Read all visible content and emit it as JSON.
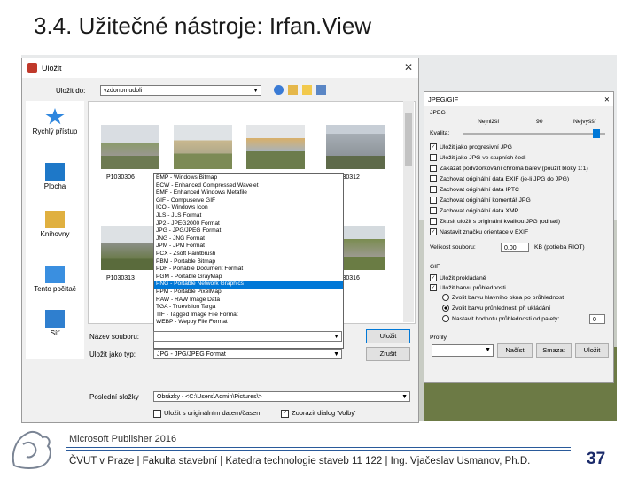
{
  "slide": {
    "title": "3.4. Užitečné nástroje: Irfan.View",
    "publisher": "Microsoft Publisher  2016",
    "footer": "ČVUT v Praze | Fakulta stavební | Katedra technologie staveb 11 122 | Ing. Vjačeslav Usmanov, Ph.D.",
    "page_number": "37"
  },
  "dialog": {
    "title": "Uložit",
    "close": "✕",
    "save_in_label": "Uložit do:",
    "save_in_value": "vzdonomudoli",
    "places": [
      "Rychlý přístup",
      "Plocha",
      "Knihovny",
      "Tento počítač",
      "Síť"
    ],
    "thumbnails": [
      "P1030306",
      "P1030312",
      "P1030313",
      "P1030316"
    ],
    "filename_label": "Název souboru:",
    "filetype_label": "Uložit jako typ:",
    "filetype_value": "JPG - JPG/JPEG Format",
    "recent_label": "Poslední složky",
    "recent_value": "Obrázky - <C:\\Users\\Admin\\Pictures\\>",
    "save_button": "Uložit",
    "cancel_button": "Zrušit",
    "chk_keep_date": "Uložit s originálním datem/časem",
    "chk_show_dialog": "Zobrazit dialog 'Volby'",
    "file_types": [
      "BMP - Windows Bitmap",
      "ECW - Enhanced Compressed Wavelet",
      "EMF - Enhanced Windows Metafile",
      "GIF - Compuserve GIF",
      "ICO - Windows Icon",
      "JLS - JLS Format",
      "JP2 - JPEG2000 Format",
      "JPG - JPG/JPEG Format",
      "JNG - JNG Format",
      "JPM - JPM Format",
      "PCX - Zsoft Paintbrush",
      "PBM - Portable Bitmap",
      "PDF - Portable Document Format",
      "PGM - Portable GrayMap",
      "PNG - Portable Network Graphics",
      "PPM - Portable PixelMap",
      "RAW - RAW Image Data",
      "TGA - Truevision Targa",
      "TIF - Tagged Image File Format",
      "WEBP - Weppy File Format"
    ],
    "selected_type_index": 14
  },
  "jpeg_panel": {
    "title": "JPEG/GIF",
    "close": "✕",
    "group_jpeg": "JPEG",
    "q_low": "Nejnižší",
    "q_value": "90",
    "q_high": "Nejvyšší",
    "quality_label": "Kvalita:",
    "options": [
      {
        "label": "Uložit jako progresivní JPG",
        "checked": true
      },
      {
        "label": "Uložit jako JPG ve stupních šedi",
        "checked": false
      },
      {
        "label": "Zakázat podvzorkování chroma barev (použít bloky 1:1)",
        "checked": false
      },
      {
        "label": "Zachovat originální data EXIF (je-li JPG do JPG)",
        "checked": false
      },
      {
        "label": "Zachovat originální data IPTC",
        "checked": false
      },
      {
        "label": "Zachovat originální komentář JPG",
        "checked": false
      },
      {
        "label": "Zachovat originální data XMP",
        "checked": false
      },
      {
        "label": "Zkusit uložit s originální kvalitou JPG (odhad)",
        "checked": false
      },
      {
        "label": "Nastavit značku orientace v EXIF",
        "checked": true
      }
    ],
    "size_label": "Velikost souboru:",
    "size_value": "0.00",
    "size_unit": "KB (potřeba RIOT)",
    "group_gif": "GIF",
    "gif_options": [
      {
        "label": "Uložit prokládaně",
        "checked": true
      },
      {
        "label": "Uložit barvu průhlednosti",
        "checked": true
      }
    ],
    "radios": [
      {
        "label": "Zvolit barvu hlavního okna po průhlednost",
        "on": false
      },
      {
        "label": "Zvolit barvu průhlednosti při ukládání",
        "on": true
      },
      {
        "label": "Nastavit hodnotu průhlednosti od palety:",
        "on": false
      }
    ],
    "palette_value": "0",
    "profiles_label": "Profily",
    "load_button": "Načíst",
    "save_button": "Smazat",
    "help_button": "Uložit"
  }
}
